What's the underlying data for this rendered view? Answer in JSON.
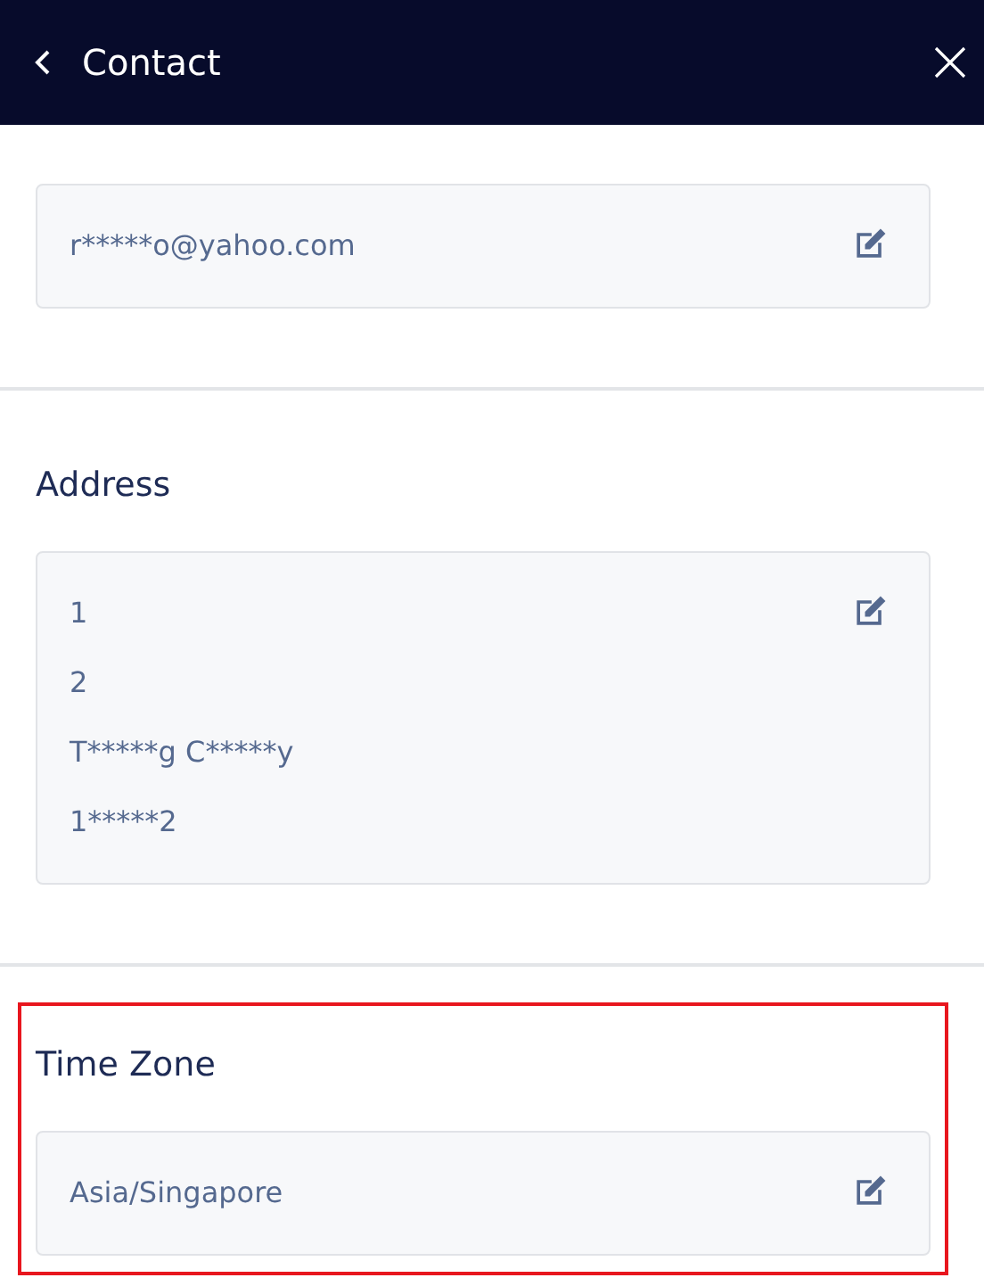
{
  "header": {
    "title": "Contact"
  },
  "sections": [
    {
      "lines": [
        "r*****o@yahoo.com"
      ],
      "highlighted": false
    },
    {
      "label": "Address",
      "lines": [
        "1",
        "2",
        "T*****g C*****y",
        "1*****2"
      ],
      "highlighted": false
    },
    {
      "label": "Time Zone",
      "lines": [
        "Asia/Singapore"
      ],
      "highlighted": true
    }
  ]
}
